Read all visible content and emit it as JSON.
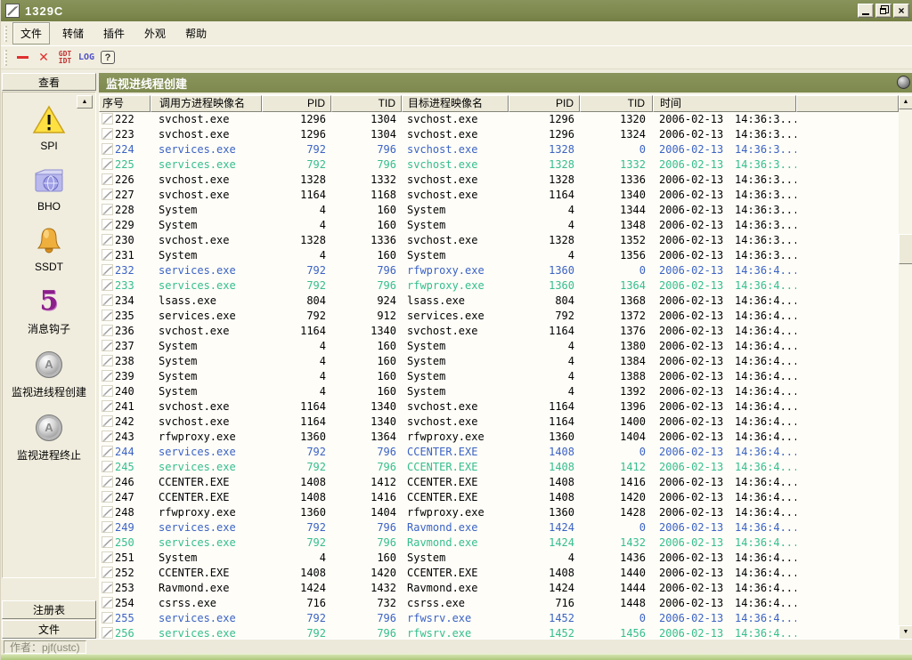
{
  "window": {
    "title": "1329C"
  },
  "menu": {
    "items": [
      "文件",
      "转储",
      "插件",
      "外观",
      "帮助"
    ]
  },
  "toolbar": {
    "gdt": "GDT",
    "idt": "IDT",
    "log": "LOG",
    "help": "?"
  },
  "icons": [
    "app-icon",
    "minimize-icon",
    "restore-icon",
    "close-icon",
    "remove-icon",
    "delete-icon",
    "gdt-idt-icon",
    "log-icon",
    "help-icon",
    "warning-triangle-icon",
    "folder-globe-icon",
    "bell-icon",
    "purple-hook-icon",
    "round-metal-icon",
    "sphere-icon",
    "thread-icon",
    "scroll-up-icon",
    "scroll-down-icon"
  ],
  "sidebar": {
    "view_button": "查看",
    "items": [
      {
        "label": "SPI",
        "icon": "warning-triangle"
      },
      {
        "label": "BHO",
        "icon": "folder-globe"
      },
      {
        "label": "SSDT",
        "icon": "bell"
      },
      {
        "label": "消息钩子",
        "icon": "purple-hook"
      },
      {
        "label": "监视进线程创建",
        "icon": "round-metal"
      },
      {
        "label": "监视进程终止",
        "icon": "round-metal"
      }
    ],
    "bottom_buttons": [
      "注册表",
      "文件"
    ]
  },
  "main": {
    "panel_title": "监视进线程创建",
    "table": {
      "columns": [
        "序号",
        "调用方进程映像名",
        "PID",
        "TID",
        "目标进程映像名",
        "PID",
        "TID",
        "时间",
        ""
      ],
      "rows": [
        [
          "222",
          "svchost.exe",
          "1296",
          "1304",
          "svchost.exe",
          "1296",
          "1320",
          "2006-02-13",
          "14:36:3...",
          "normal"
        ],
        [
          "223",
          "svchost.exe",
          "1296",
          "1304",
          "svchost.exe",
          "1296",
          "1324",
          "2006-02-13",
          "14:36:3...",
          "normal"
        ],
        [
          "224",
          "services.exe",
          "792",
          "796",
          "svchost.exe",
          "1328",
          "0",
          "2006-02-13",
          "14:36:3...",
          "blue"
        ],
        [
          "225",
          "services.exe",
          "792",
          "796",
          "svchost.exe",
          "1328",
          "1332",
          "2006-02-13",
          "14:36:3...",
          "green"
        ],
        [
          "226",
          "svchost.exe",
          "1328",
          "1332",
          "svchost.exe",
          "1328",
          "1336",
          "2006-02-13",
          "14:36:3...",
          "normal"
        ],
        [
          "227",
          "svchost.exe",
          "1164",
          "1168",
          "svchost.exe",
          "1164",
          "1340",
          "2006-02-13",
          "14:36:3...",
          "normal"
        ],
        [
          "228",
          "System",
          "4",
          "160",
          "System",
          "4",
          "1344",
          "2006-02-13",
          "14:36:3...",
          "normal"
        ],
        [
          "229",
          "System",
          "4",
          "160",
          "System",
          "4",
          "1348",
          "2006-02-13",
          "14:36:3...",
          "normal"
        ],
        [
          "230",
          "svchost.exe",
          "1328",
          "1336",
          "svchost.exe",
          "1328",
          "1352",
          "2006-02-13",
          "14:36:3...",
          "normal"
        ],
        [
          "231",
          "System",
          "4",
          "160",
          "System",
          "4",
          "1356",
          "2006-02-13",
          "14:36:3...",
          "normal"
        ],
        [
          "232",
          "services.exe",
          "792",
          "796",
          "rfwproxy.exe",
          "1360",
          "0",
          "2006-02-13",
          "14:36:4...",
          "blue"
        ],
        [
          "233",
          "services.exe",
          "792",
          "796",
          "rfwproxy.exe",
          "1360",
          "1364",
          "2006-02-13",
          "14:36:4...",
          "green"
        ],
        [
          "234",
          "lsass.exe",
          "804",
          "924",
          "lsass.exe",
          "804",
          "1368",
          "2006-02-13",
          "14:36:4...",
          "normal"
        ],
        [
          "235",
          "services.exe",
          "792",
          "912",
          "services.exe",
          "792",
          "1372",
          "2006-02-13",
          "14:36:4...",
          "normal"
        ],
        [
          "236",
          "svchost.exe",
          "1164",
          "1340",
          "svchost.exe",
          "1164",
          "1376",
          "2006-02-13",
          "14:36:4...",
          "normal"
        ],
        [
          "237",
          "System",
          "4",
          "160",
          "System",
          "4",
          "1380",
          "2006-02-13",
          "14:36:4...",
          "normal"
        ],
        [
          "238",
          "System",
          "4",
          "160",
          "System",
          "4",
          "1384",
          "2006-02-13",
          "14:36:4...",
          "normal"
        ],
        [
          "239",
          "System",
          "4",
          "160",
          "System",
          "4",
          "1388",
          "2006-02-13",
          "14:36:4...",
          "normal"
        ],
        [
          "240",
          "System",
          "4",
          "160",
          "System",
          "4",
          "1392",
          "2006-02-13",
          "14:36:4...",
          "normal"
        ],
        [
          "241",
          "svchost.exe",
          "1164",
          "1340",
          "svchost.exe",
          "1164",
          "1396",
          "2006-02-13",
          "14:36:4...",
          "normal"
        ],
        [
          "242",
          "svchost.exe",
          "1164",
          "1340",
          "svchost.exe",
          "1164",
          "1400",
          "2006-02-13",
          "14:36:4...",
          "normal"
        ],
        [
          "243",
          "rfwproxy.exe",
          "1360",
          "1364",
          "rfwproxy.exe",
          "1360",
          "1404",
          "2006-02-13",
          "14:36:4...",
          "normal"
        ],
        [
          "244",
          "services.exe",
          "792",
          "796",
          "CCENTER.EXE",
          "1408",
          "0",
          "2006-02-13",
          "14:36:4...",
          "blue"
        ],
        [
          "245",
          "services.exe",
          "792",
          "796",
          "CCENTER.EXE",
          "1408",
          "1412",
          "2006-02-13",
          "14:36:4...",
          "green"
        ],
        [
          "246",
          "CCENTER.EXE",
          "1408",
          "1412",
          "CCENTER.EXE",
          "1408",
          "1416",
          "2006-02-13",
          "14:36:4...",
          "normal"
        ],
        [
          "247",
          "CCENTER.EXE",
          "1408",
          "1416",
          "CCENTER.EXE",
          "1408",
          "1420",
          "2006-02-13",
          "14:36:4...",
          "normal"
        ],
        [
          "248",
          "rfwproxy.exe",
          "1360",
          "1404",
          "rfwproxy.exe",
          "1360",
          "1428",
          "2006-02-13",
          "14:36:4...",
          "normal"
        ],
        [
          "249",
          "services.exe",
          "792",
          "796",
          "Ravmond.exe",
          "1424",
          "0",
          "2006-02-13",
          "14:36:4...",
          "blue"
        ],
        [
          "250",
          "services.exe",
          "792",
          "796",
          "Ravmond.exe",
          "1424",
          "1432",
          "2006-02-13",
          "14:36:4...",
          "green"
        ],
        [
          "251",
          "System",
          "4",
          "160",
          "System",
          "4",
          "1436",
          "2006-02-13",
          "14:36:4...",
          "normal"
        ],
        [
          "252",
          "CCENTER.EXE",
          "1408",
          "1420",
          "CCENTER.EXE",
          "1408",
          "1440",
          "2006-02-13",
          "14:36:4...",
          "normal"
        ],
        [
          "253",
          "Ravmond.exe",
          "1424",
          "1432",
          "Ravmond.exe",
          "1424",
          "1444",
          "2006-02-13",
          "14:36:4...",
          "normal"
        ],
        [
          "254",
          "csrss.exe",
          "716",
          "732",
          "csrss.exe",
          "716",
          "1448",
          "2006-02-13",
          "14:36:4...",
          "normal"
        ],
        [
          "255",
          "services.exe",
          "792",
          "796",
          "rfwsrv.exe",
          "1452",
          "0",
          "2006-02-13",
          "14:36:4...",
          "blue"
        ],
        [
          "256",
          "services.exe",
          "792",
          "796",
          "rfwsrv.exe",
          "1452",
          "1456",
          "2006-02-13",
          "14:36:4...",
          "green"
        ]
      ]
    }
  },
  "statusbar": {
    "author": "作者：pjf(ustc)"
  },
  "colors": {
    "titlebar": "#7D894E",
    "row_blue": "#3B63C4",
    "row_green": "#35BE8F",
    "background": "#EFECDD",
    "strip_green": "#AEC87C"
  }
}
